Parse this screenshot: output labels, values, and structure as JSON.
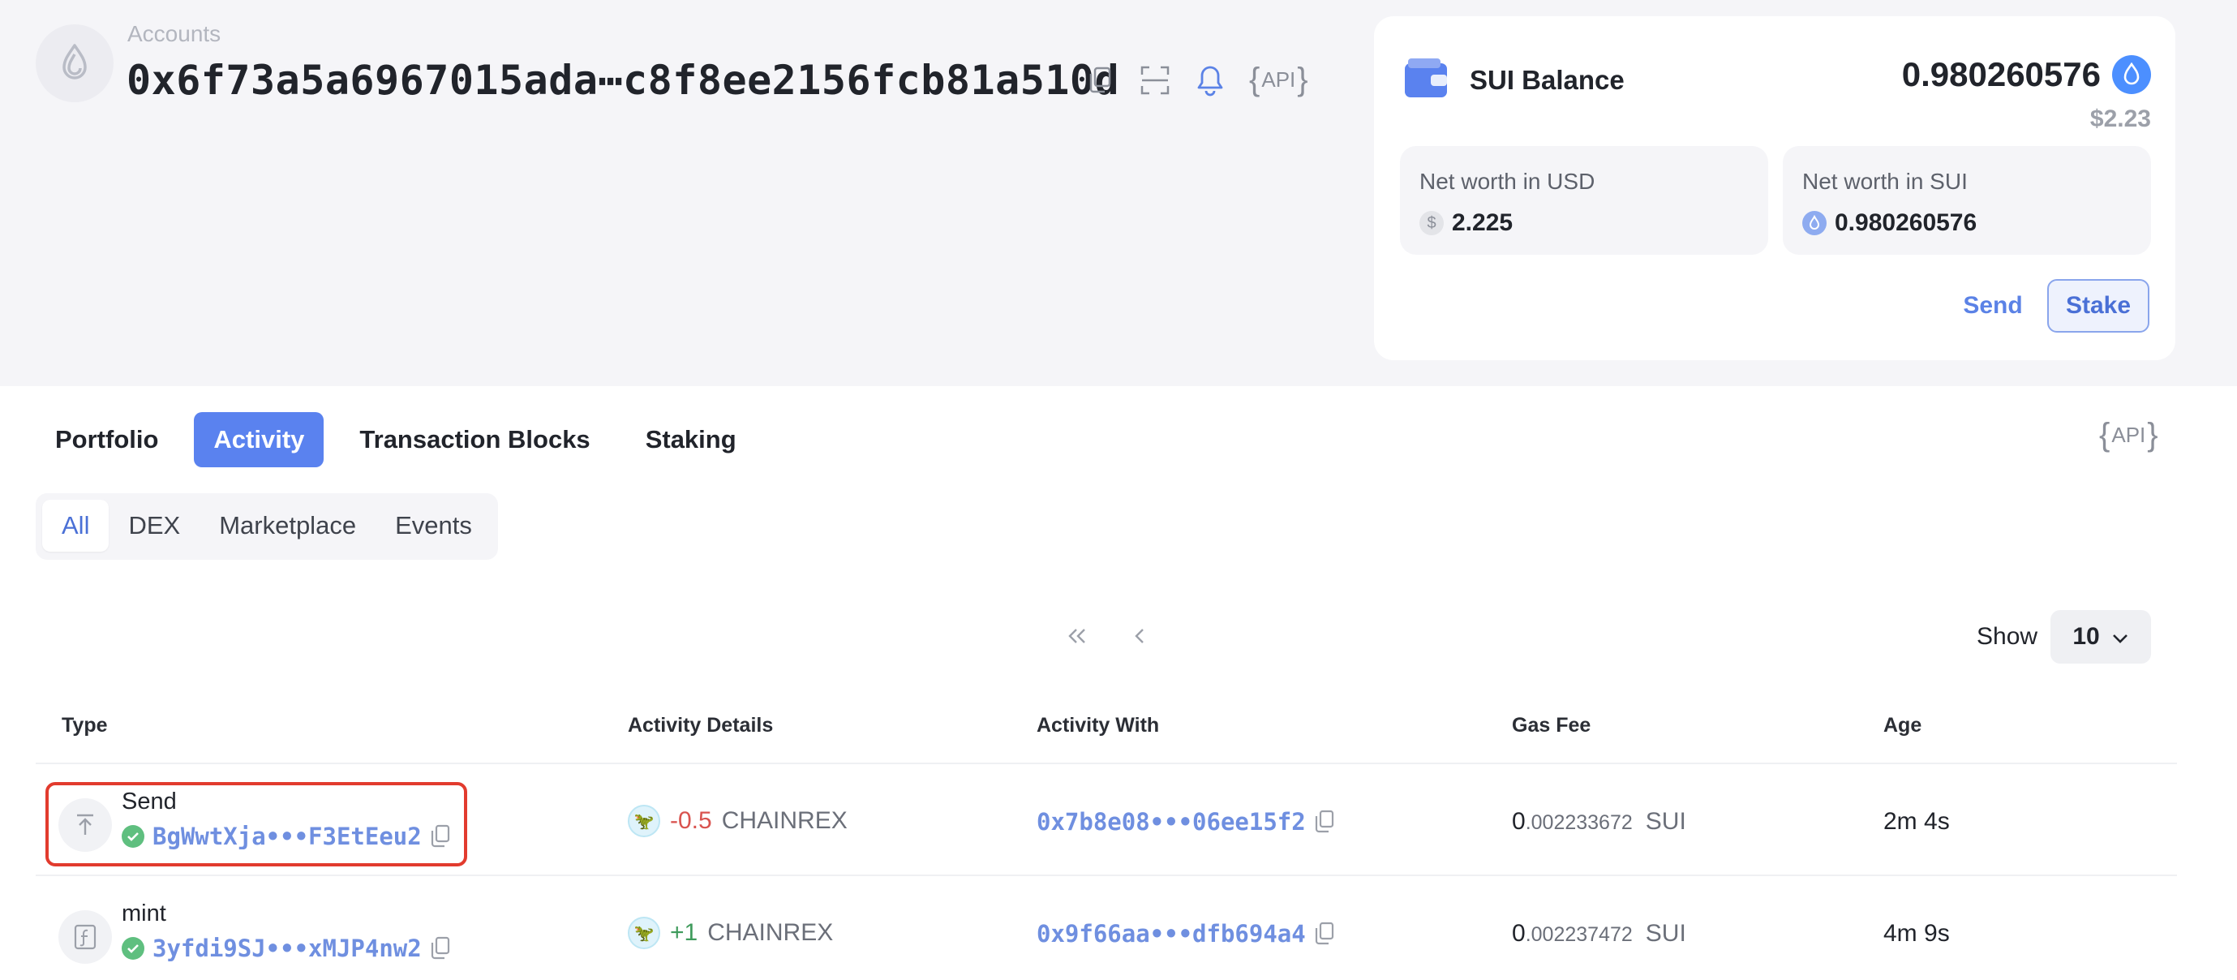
{
  "account": {
    "label": "Accounts",
    "address": "0x6f73a5a6967015ada⋯c8f8ee2156fcb81a510d",
    "api_label": "API"
  },
  "balance": {
    "title": "SUI Balance",
    "amount": "0.980260576",
    "usd": "$2.23",
    "net_usd_label": "Net worth in USD",
    "net_usd_value": "2.225",
    "net_sui_label": "Net worth in SUI",
    "net_sui_value": "0.980260576",
    "send_label": "Send",
    "stake_label": "Stake"
  },
  "tabs": [
    {
      "label": "Portfolio",
      "active": false
    },
    {
      "label": "Activity",
      "active": true
    },
    {
      "label": "Transaction Blocks",
      "active": false
    },
    {
      "label": "Staking",
      "active": false
    }
  ],
  "filters": [
    {
      "label": "All",
      "active": true
    },
    {
      "label": "DEX",
      "active": false
    },
    {
      "label": "Marketplace",
      "active": false
    },
    {
      "label": "Events",
      "active": false
    }
  ],
  "pagination": {
    "show_label": "Show",
    "page_size": "10"
  },
  "table": {
    "columns": [
      "Type",
      "Activity Details",
      "Activity With",
      "Gas Fee",
      "Age"
    ],
    "rows": [
      {
        "type": "Send",
        "digest": "BgWwtXja•••F3EtEeu2",
        "sign": "-0.5",
        "token": "CHAINREX",
        "with": "0x7b8e08•••06ee15f2",
        "gas_int": "0",
        "gas_frac": ".002233672",
        "gas_unit": "SUI",
        "age": "2m 4s"
      },
      {
        "type": "mint",
        "digest": "3yfdi9SJ•••xMJP4nw2",
        "sign": "+1",
        "token": "CHAINREX",
        "with": "0x9f66aa•••dfb694a4",
        "gas_int": "0",
        "gas_frac": ".002237472",
        "gas_unit": "SUI",
        "age": "4m 9s"
      }
    ]
  },
  "colors": {
    "accent": "#5a82ef",
    "link": "#6f8fe0",
    "success": "#5fbf7f",
    "negative": "#d9534f",
    "positive": "#3f9b5c",
    "highlight": "#e23b2e"
  }
}
